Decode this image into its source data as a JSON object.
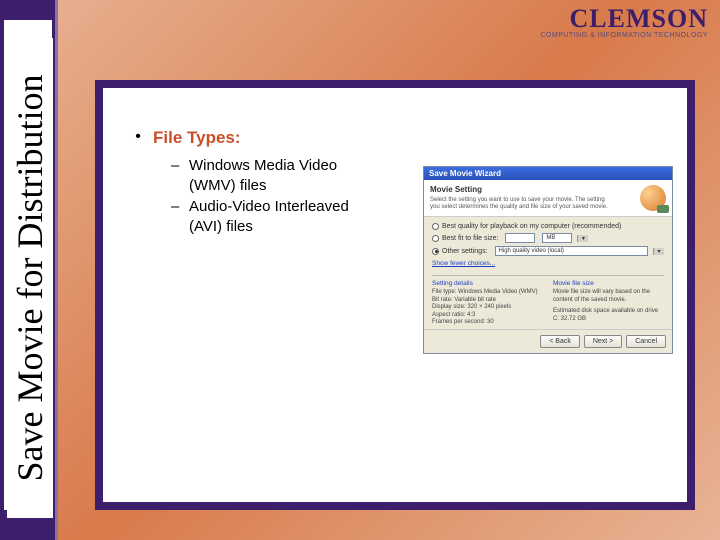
{
  "sidebar": {
    "title": "Save Movie for Distribution"
  },
  "logo": {
    "main": "CLEMSON",
    "sub": "COMPUTING & INFORMATION TECHNOLOGY"
  },
  "content": {
    "bullet_symbol": "•",
    "heading": "File Types:",
    "dash": "–",
    "items": [
      "Windows Media Video (WMV) files",
      "Audio-Video Interleaved (AVI) files"
    ]
  },
  "wizard": {
    "titlebar": "Save Movie Wizard",
    "header_title": "Movie Setting",
    "header_sub": "Select the setting you want to use to save your movie. The setting you select determines the quality and file size of your saved movie.",
    "radio1": "Best quality for playback on my computer (recommended)",
    "radio2": "Best fit to file size:",
    "radio2_value": "MB",
    "radio3": "Other settings:",
    "radio3_value": "High quality video (local)",
    "show_more": "Show fewer choices...",
    "details_left_head": "Setting details",
    "details_left": [
      "File type: Windows Media Video (WMV)",
      "Bit rate: Variable bit rate",
      "Display size: 320 × 240 pixels",
      "Aspect ratio: 4:3",
      "Frames per second: 30"
    ],
    "details_right_head": "Movie file size",
    "details_right": [
      "Movie file size will vary based on the content of the saved movie.",
      "Estimated disk space available on drive C: 32.72 GB"
    ],
    "btn_back": "< Back",
    "btn_next": "Next >",
    "btn_cancel": "Cancel"
  }
}
